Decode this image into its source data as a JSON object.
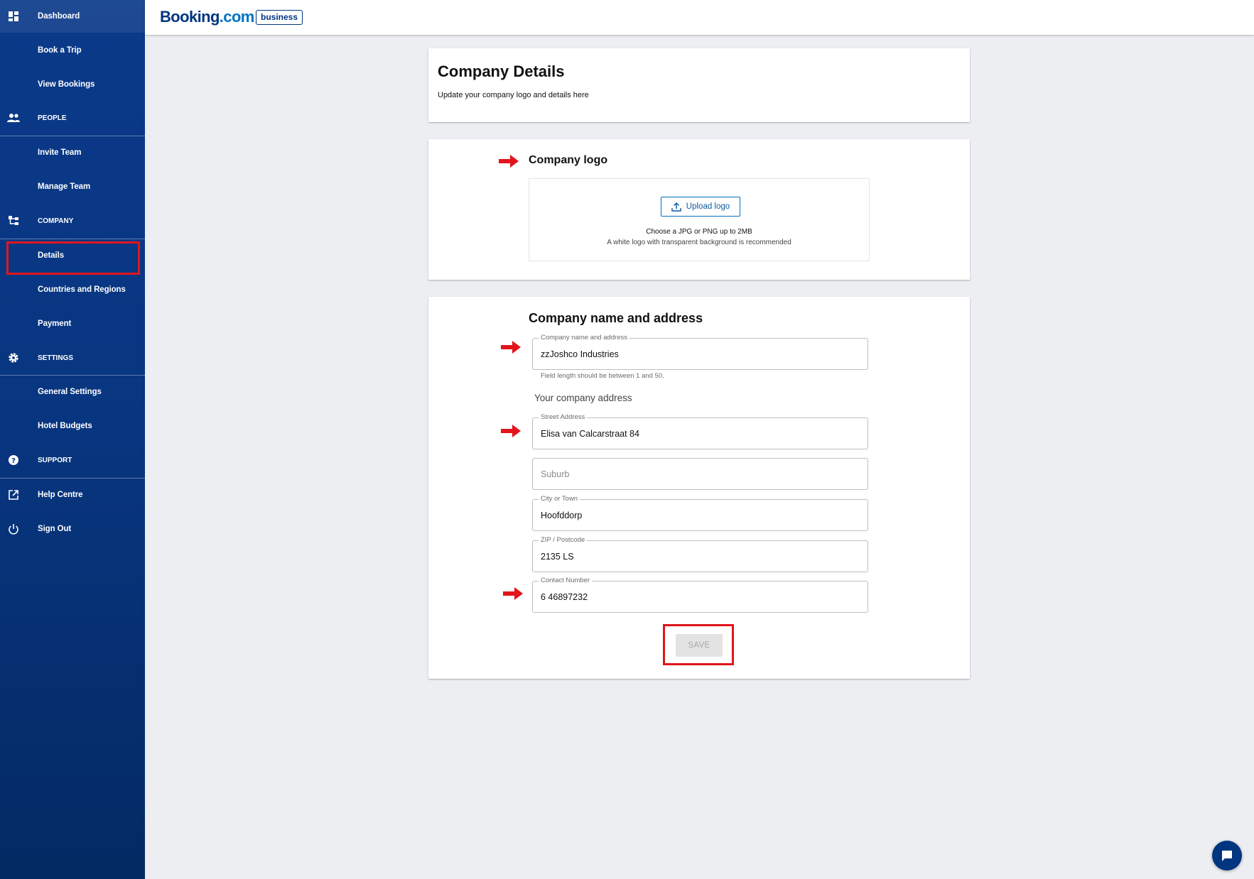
{
  "sidebar": {
    "items": [
      {
        "label": "Dashboard",
        "icon": "dashboard-icon"
      },
      {
        "label": "Book a Trip"
      },
      {
        "label": "View Bookings"
      },
      {
        "label": "PEOPLE",
        "icon": "people-icon"
      },
      {
        "label": "Invite Team"
      },
      {
        "label": "Manage Team"
      },
      {
        "label": "COMPANY",
        "icon": "company-tree-icon"
      },
      {
        "label": "Details"
      },
      {
        "label": "Countries and Regions"
      },
      {
        "label": "Payment"
      },
      {
        "label": "SETTINGS",
        "icon": "gear-icon"
      },
      {
        "label": "General Settings"
      },
      {
        "label": "Hotel Budgets"
      },
      {
        "label": "SUPPORT",
        "icon": "help-circle-icon"
      },
      {
        "label": "Help Centre",
        "icon": "external-link-icon"
      },
      {
        "label": "Sign Out",
        "icon": "power-icon"
      }
    ],
    "active": "Details"
  },
  "header": {
    "brand_main": "Booking",
    "brand_dotcom": ".com",
    "brand_badge": "business"
  },
  "details_card": {
    "title": "Company Details",
    "subtitle": "Update your company logo and details here"
  },
  "logo_card": {
    "title": "Company logo",
    "upload_label": "Upload logo",
    "hint1": "Choose a JPG or PNG up to 2MB",
    "hint2": "A white logo with transparent background is recommended"
  },
  "address_card": {
    "title": "Company name and address",
    "company_name": {
      "label": "Company name and address",
      "value": "zzJoshco Industries"
    },
    "helper": "Field length should be between 1 and 50.",
    "address_title": "Your company address",
    "street": {
      "label": "Street Address",
      "value": "Elisa van Calcarstraat 84"
    },
    "suburb": {
      "placeholder": "Suburb",
      "value": ""
    },
    "city": {
      "label": "City or Town",
      "value": "Hoofddorp"
    },
    "zip": {
      "label": "ZIP / Postcode",
      "value": "2135 LS"
    },
    "contact": {
      "label": "Contact Number",
      "value": "6 46897232"
    },
    "save_label": "SAVE"
  },
  "colors": {
    "sidebar": "#0b3a8a",
    "accent": "#0071c2",
    "annotation_red": "#e2151b"
  }
}
